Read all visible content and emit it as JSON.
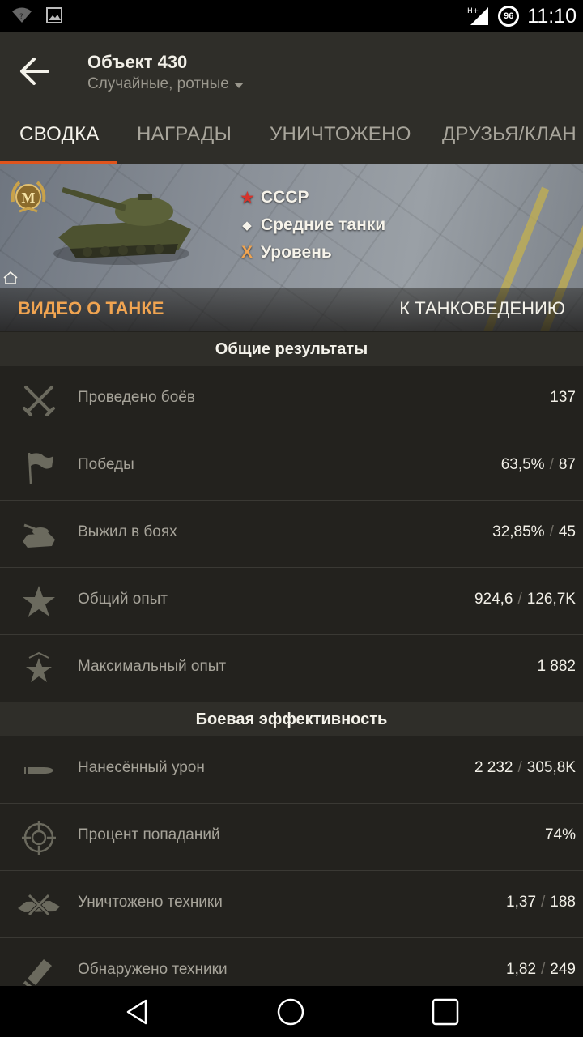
{
  "status_bar": {
    "network": "H+",
    "battery": "96",
    "time": "11:10"
  },
  "header": {
    "title": "Объект 430",
    "subtitle": "Случайные, ротные"
  },
  "tabs": [
    {
      "label": "СВОДКА",
      "active": true
    },
    {
      "label": "НАГРАДЫ",
      "active": false
    },
    {
      "label": "УНИЧТОЖЕНО",
      "active": false
    },
    {
      "label": "ДРУЗЬЯ/КЛАН",
      "active": false
    }
  ],
  "banner": {
    "mastery_badge": "М",
    "nation_symbol": "★",
    "nation": "СССР",
    "class_symbol": "◆",
    "tank_class": "Средние танки",
    "tier_symbol": "X",
    "tier": "Уровень",
    "video_link": "ВИДЕО О ТАНКЕ",
    "tankopedia_link": "К ТАНКОВЕДЕНИЮ"
  },
  "sections": [
    {
      "title": "Общие результаты",
      "rows": [
        {
          "icon": "crossed-swords-icon",
          "label": "Проведено боёв",
          "value": "137",
          "value2": ""
        },
        {
          "icon": "flag-icon",
          "label": "Победы",
          "value": "63,5%",
          "value2": "87"
        },
        {
          "icon": "tank-icon",
          "label": "Выжил в боях",
          "value": "32,85%",
          "value2": "45"
        },
        {
          "icon": "star-icon",
          "label": "Общий опыт",
          "value": "924,6",
          "value2": "126,7K"
        },
        {
          "icon": "star-crown-icon",
          "label": "Максимальный опыт",
          "value": "1 882",
          "value2": ""
        }
      ]
    },
    {
      "title": "Боевая эффективность",
      "rows": [
        {
          "icon": "shell-icon",
          "label": "Нанесённый урон",
          "value": "2 232",
          "value2": "305,8K"
        },
        {
          "icon": "crosshair-icon",
          "label": "Процент попаданий",
          "value": "74%",
          "value2": ""
        },
        {
          "icon": "destroyed-tank-icon",
          "label": "Уничтожено техники",
          "value": "1,37",
          "value2": "188"
        },
        {
          "icon": "binoculars-icon",
          "label": "Обнаружено техники",
          "value": "1,82",
          "value2": "249"
        }
      ]
    }
  ],
  "colors": {
    "accent": "#e0541c",
    "link_orange": "#f0a451",
    "background": "#23221e",
    "header": "#2f2e29"
  }
}
